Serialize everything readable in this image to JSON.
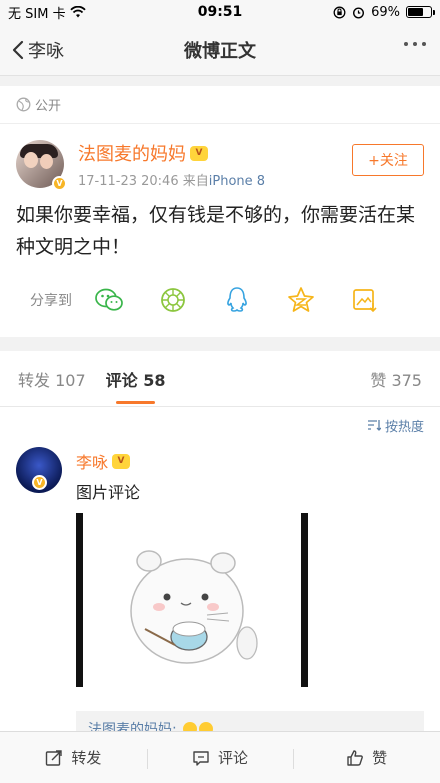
{
  "status_bar": {
    "carrier": "无 SIM 卡",
    "time": "09:51",
    "battery_percent": "69%",
    "battery_level": 0.69
  },
  "nav": {
    "back_label": "李咏",
    "title": "微博正文"
  },
  "visibility": {
    "label": "公开"
  },
  "post": {
    "author": "法图麦的妈妈",
    "date": "17-11-23 20:46",
    "source_prefix": "来自",
    "device": "iPhone 8",
    "follow_label": "+关注",
    "text": "如果你要幸福，仅有钱是不够的，你需要活在某种文明之中！",
    "share_label": "分享到",
    "share_targets": [
      "wechat-icon",
      "moments-icon",
      "qq-icon",
      "qzone-icon",
      "save-image-icon"
    ]
  },
  "tabs": {
    "reposts": "转发 107",
    "comments": "评论 58",
    "likes": "赞 375"
  },
  "sort": {
    "label": "按热度"
  },
  "comment": {
    "author": "李咏",
    "text": "图片评论",
    "reply_author": "法图麦的妈妈:"
  },
  "bottom_bar": {
    "repost": "转发",
    "comment": "评论",
    "like": "赞"
  },
  "colors": {
    "accent": "#f7782b",
    "link": "#5b7fa8",
    "verified": "#f7b526"
  }
}
